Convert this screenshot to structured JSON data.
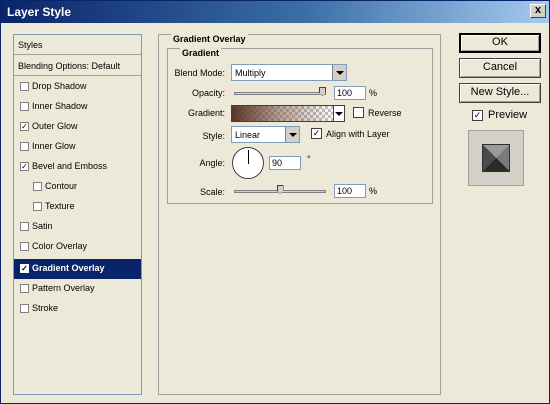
{
  "window": {
    "title": "Layer Style",
    "close": "x"
  },
  "styles_panel": {
    "header": "Styles",
    "blending": "Blending Options: Default",
    "items": [
      {
        "label": "Drop Shadow",
        "checked": ""
      },
      {
        "label": "Inner Shadow",
        "checked": ""
      },
      {
        "label": "Outer Glow",
        "checked": "✓"
      },
      {
        "label": "Inner Glow",
        "checked": ""
      },
      {
        "label": "Bevel and Emboss",
        "checked": "✓"
      },
      {
        "label": "Contour",
        "checked": ""
      },
      {
        "label": "Texture",
        "checked": ""
      },
      {
        "label": "Satin",
        "checked": ""
      },
      {
        "label": "Color Overlay",
        "checked": ""
      },
      {
        "label": "Gradient Overlay",
        "checked": "✓"
      },
      {
        "label": "Pattern Overlay",
        "checked": ""
      },
      {
        "label": "Stroke",
        "checked": ""
      }
    ]
  },
  "gradient_overlay": {
    "title": "Gradient Overlay",
    "subtitle": "Gradient",
    "blend_mode_label": "Blend Mode:",
    "blend_mode_value": "Multiply",
    "opacity_label": "Opacity:",
    "opacity_value": "100",
    "opacity_unit": "%",
    "opacity_level": 1.0,
    "gradient_label": "Gradient:",
    "reverse_label": "Reverse",
    "reverse_checked": "",
    "style_label": "Style:",
    "style_value": "Linear",
    "align_label": "Align with Layer",
    "align_checked": "✓",
    "angle_label": "Angle:",
    "angle_value": "90",
    "angle_unit": "°",
    "scale_label": "Scale:",
    "scale_value": "100",
    "scale_unit": "%",
    "scale_level": 0.5
  },
  "buttons": {
    "ok": "OK",
    "cancel": "Cancel",
    "new_style": "New Style...",
    "preview_label": "Preview",
    "preview_checked": "✓"
  },
  "colors": {
    "titlebar": "#0a246a",
    "selected": "#0a246a",
    "gradient_start": "#5a3525"
  }
}
